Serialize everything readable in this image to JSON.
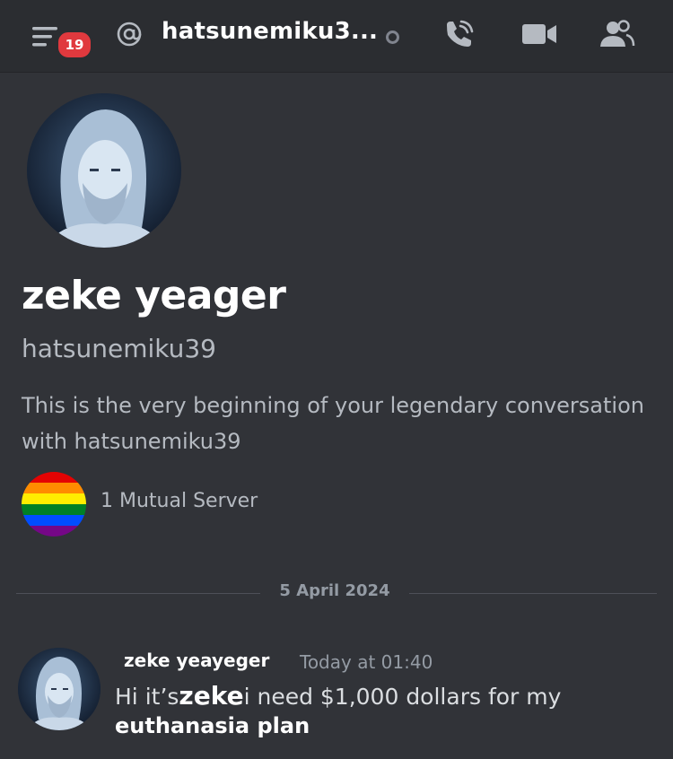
{
  "header": {
    "unread_count": "19",
    "title": "hatsunemiku3...",
    "icons": [
      "menu-icon",
      "at-icon",
      "status-dot",
      "call-icon",
      "video-icon",
      "members-icon"
    ]
  },
  "profile": {
    "display_name": "zeke yeager",
    "username": "hatsunemiku39",
    "intro": "This is the very beginning of your legendary conversation with hatsunemiku39",
    "mutual_servers": "1 Mutual Server"
  },
  "divider": {
    "date": "5 April 2024"
  },
  "message": {
    "author": "zeke yeayeger",
    "timestamp": "Today at 01:40",
    "text_prefix": "Hi it’s",
    "text_bold": "zeke",
    "text_rest": "i need $1,000 dollars for my",
    "text_line2": "euthanasia plan"
  },
  "colors": {
    "background": "#313338",
    "header": "#2b2d31",
    "badge": "#e0393e",
    "muted_text": "#b5bac1",
    "timestamp": "#949ba4"
  }
}
